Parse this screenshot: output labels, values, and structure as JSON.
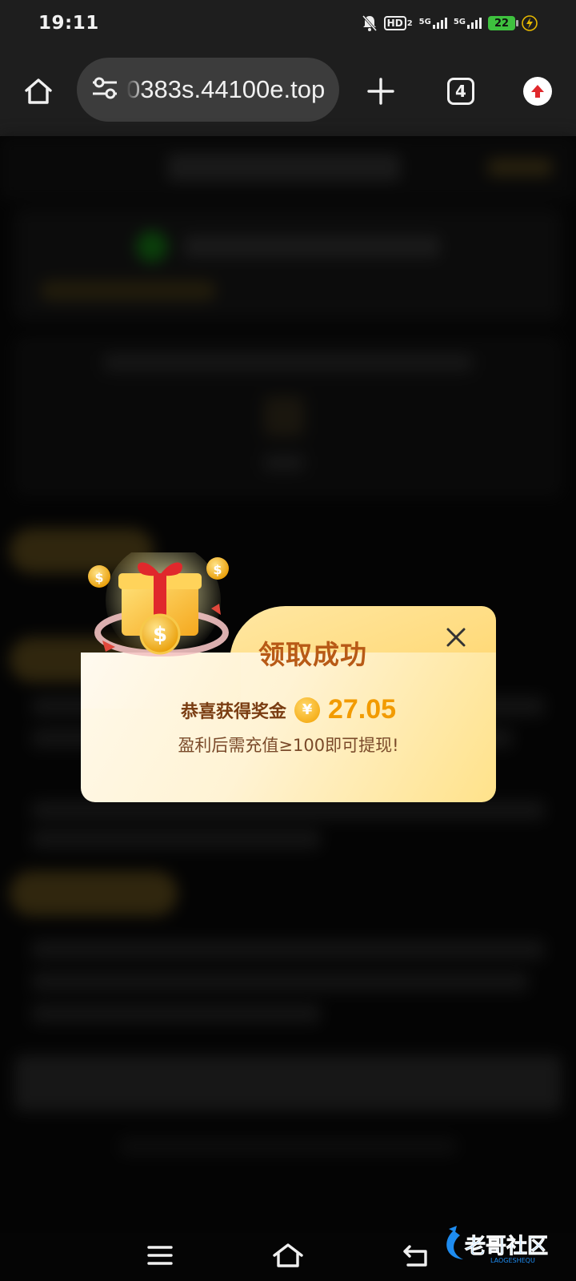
{
  "status_bar": {
    "time": "19:11",
    "hd_label": "HD",
    "hd_sub": "2",
    "network_1": "5G",
    "network_2": "5G",
    "battery": "22"
  },
  "browser": {
    "url": "0383s.44100e.top",
    "tab_count": "4"
  },
  "dialog": {
    "title": "领取成功",
    "reward_label": "恭喜获得奖金",
    "currency_symbol": "¥",
    "reward_amount": "27.05",
    "note": "盈利后需充值≥100即可提现!"
  },
  "colors": {
    "title": "#b85a16",
    "amount": "#f29b00",
    "dialog_bg": "#fff3d4"
  },
  "icons": {
    "home": "home-icon",
    "site_settings": "tune-icon",
    "new_tab": "plus-icon",
    "upload": "upload-icon",
    "close": "close-icon",
    "menu": "menu-icon",
    "nav_home": "nav-home-icon",
    "back": "back-icon"
  },
  "watermark": {
    "brand": "老哥社区",
    "brand_latin": "LAOGESHEQU"
  }
}
